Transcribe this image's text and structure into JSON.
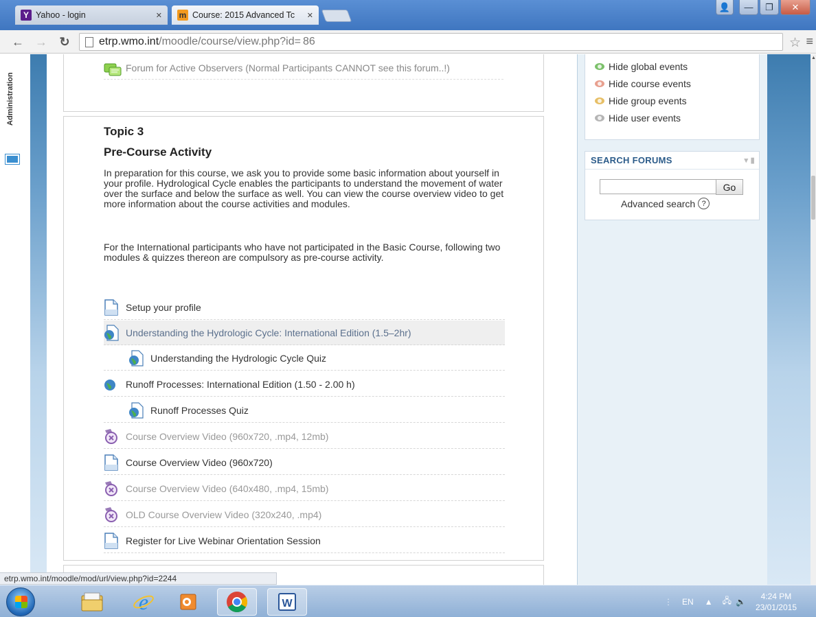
{
  "browser": {
    "tabs": [
      {
        "title": "Yahoo - login",
        "favicon": "yahoo-icon",
        "active": false
      },
      {
        "title": "Course: 2015 Advanced Tc",
        "favicon": "moodle-icon",
        "active": true
      }
    ],
    "url_host": "etrp.wmo.int",
    "url_path": "/moodle/course/view.php?id=",
    "url_id": "86",
    "status_url": "etrp.wmo.int/moodle/mod/url/view.php?id=2244"
  },
  "admin_strip": {
    "label": "Administration"
  },
  "forum_section": {
    "forum_label": "Forum for Active Observers (Normal Participants CANNOT see this forum..!)"
  },
  "topic": {
    "number_label": "Topic 3",
    "title": "Pre-Course Activity",
    "paragraph1": "In preparation for this course, we ask you to provide some basic information about yourself in your profile. Hydrological Cycle enables the participants to understand the movement of water over the surface and below the surface as well. You can view the course overview video to get more information about the course activities and modules.",
    "paragraph2": "For the International participants who have not participated in the Basic Course, following two modules & quizzes thereon are compulsory as pre-course activity.",
    "activities": [
      {
        "label": "Setup your profile",
        "icon": "page-icon"
      },
      {
        "label": "Understanding the Hydrologic Cycle: International Edition (1.5–2hr)",
        "icon": "globe-icon"
      },
      {
        "label": "Understanding the Hydrologic Cycle Quiz",
        "icon": "globe-page-icon"
      },
      {
        "label": "Runoff Processes: International Edition (1.50 - 2.00 h)",
        "icon": "globe-icon"
      },
      {
        "label": "Runoff Processes Quiz",
        "icon": "globe-page-icon"
      },
      {
        "label": "Course Overview Video (960x720, .mp4, 12mb)",
        "icon": "video-icon"
      },
      {
        "label": "Course Overview Video (960x720)",
        "icon": "page-icon"
      },
      {
        "label": "Course Overview Video (640x480, .mp4, 15mb)",
        "icon": "video-icon"
      },
      {
        "label": "OLD Course Overview Video (320x240, .mp4)",
        "icon": "video-icon"
      },
      {
        "label": "Register for Live Webinar Orientation Session",
        "icon": "page-icon"
      }
    ]
  },
  "calendar_block": {
    "events": [
      {
        "label": "Hide global events",
        "color": "#7cc16b"
      },
      {
        "label": "Hide course events",
        "color": "#e8a08f"
      },
      {
        "label": "Hide group events",
        "color": "#e7bf67"
      },
      {
        "label": "Hide user events",
        "color": "#b5b5b5"
      }
    ]
  },
  "search_forums": {
    "header": "SEARCH FORUMS",
    "go_label": "Go",
    "advanced_label": "Advanced search",
    "help_glyph": "?"
  },
  "taskbar": {
    "lang": "EN",
    "time": "4:24 PM",
    "date": "23/01/2015"
  },
  "colors": {
    "accent": "#2c5c8a",
    "sidebar_bg": "#e8f1f7"
  }
}
